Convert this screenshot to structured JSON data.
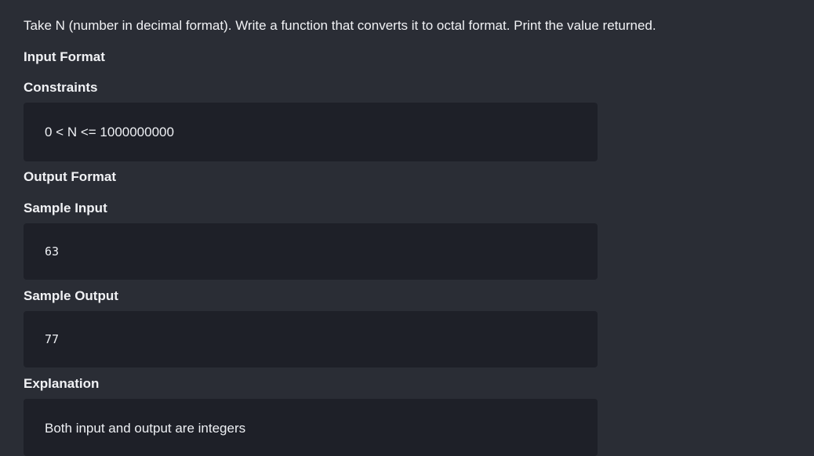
{
  "problem": {
    "statement": "Take N (number in decimal format). Write a function that converts it to octal format. Print the value returned.",
    "sections": {
      "input_format": {
        "heading": "Input Format"
      },
      "constraints": {
        "heading": "Constraints",
        "content": "0 < N <= 1000000000"
      },
      "output_format": {
        "heading": "Output Format"
      },
      "sample_input": {
        "heading": "Sample Input",
        "content": "63"
      },
      "sample_output": {
        "heading": "Sample Output",
        "content": "77"
      },
      "explanation": {
        "heading": "Explanation",
        "content": "Both input and output are integers"
      }
    }
  }
}
